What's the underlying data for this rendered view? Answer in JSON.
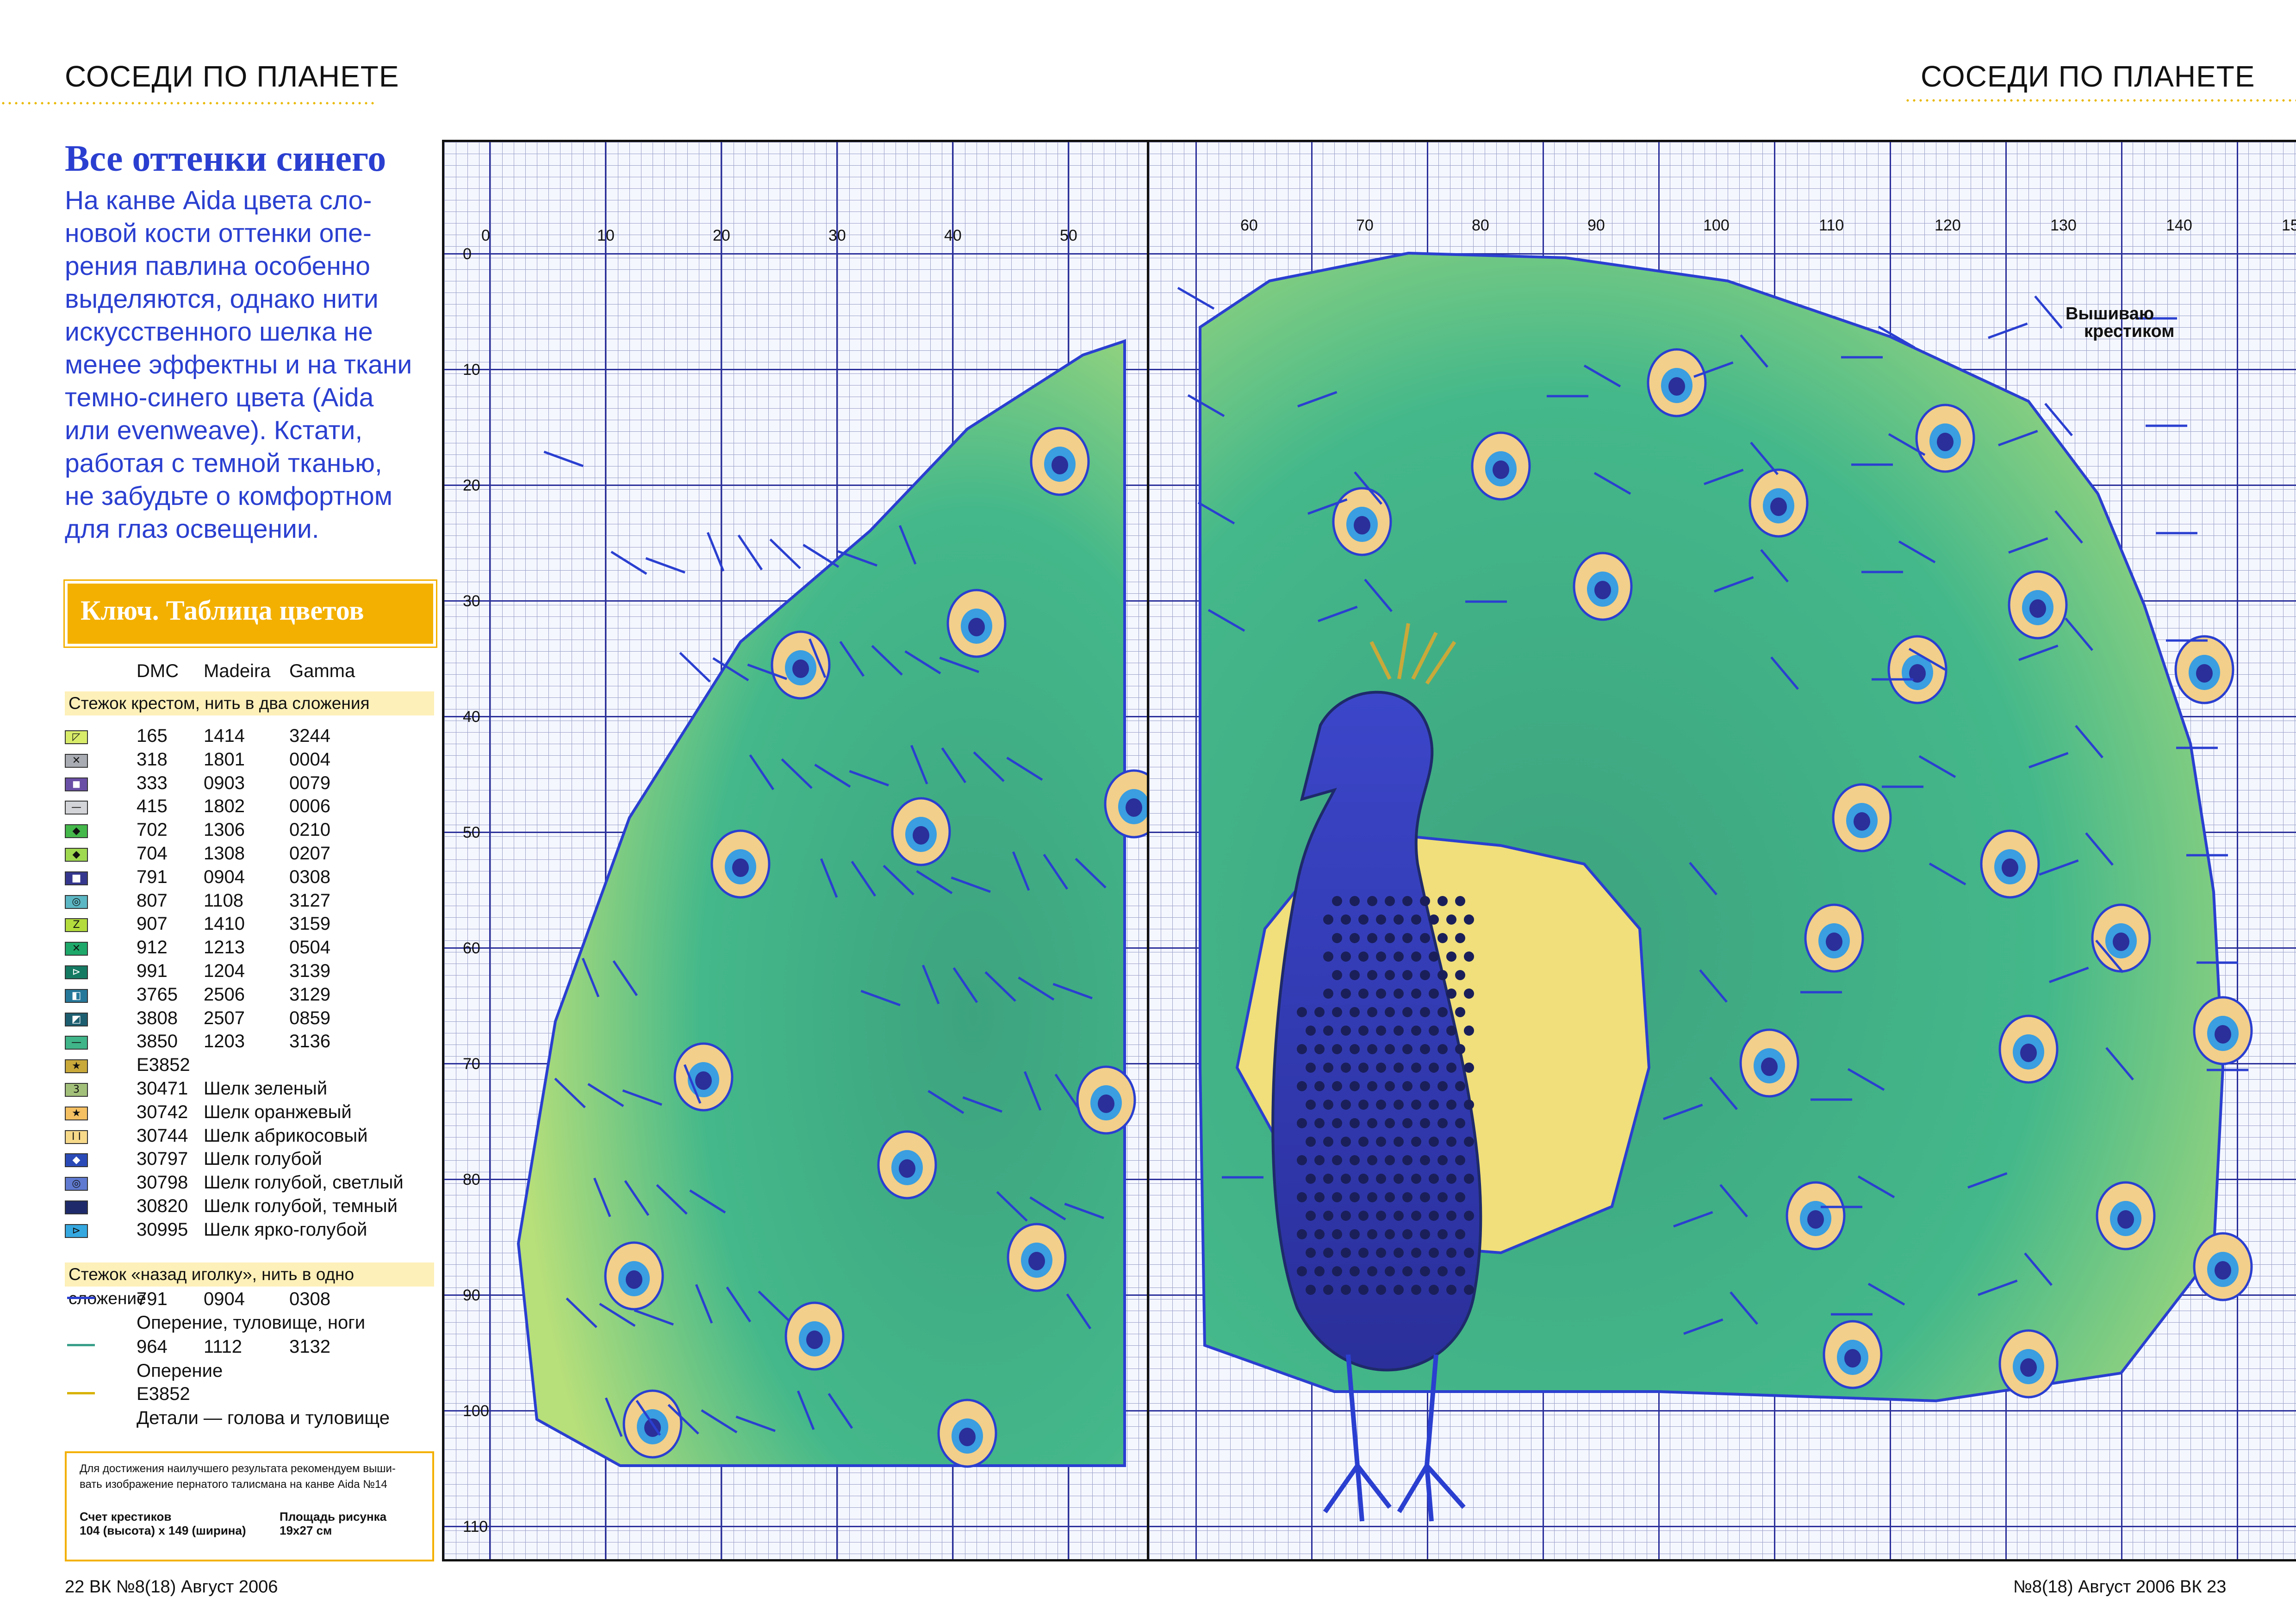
{
  "header": {
    "left_section": "СОСЕДИ ПО ПЛАНЕТЕ",
    "right_section": "СОСЕДИ ПО ПЛАНЕТЕ"
  },
  "article": {
    "headline": "Все оттенки синего",
    "intro_lines": [
      "На канве Aida цвета сло-",
      "новой кости оттенки опе-",
      "рения павлина особенно",
      "выделяются, однако нити",
      "искусственного шелка не",
      "менее эффектны и на ткани",
      "темно-синего цвета (Aida",
      "или evenweave). Кстати,",
      "работая с темной тканью,",
      "не забудьте о комфортном",
      "для глаз освещении."
    ]
  },
  "key": {
    "title": "Ключ. Таблица цветов",
    "columns": [
      "DMC",
      "Madeira",
      "Gamma"
    ],
    "cross_stitch_title": "Стежок крестом, нить в два сложения",
    "rows": [
      {
        "dmc": "165",
        "madeira": "1414",
        "gamma": "3244",
        "color": "#d9ec6a",
        "symbol": "◸"
      },
      {
        "dmc": "318",
        "madeira": "1801",
        "gamma": "0004",
        "color": "#a9acb2",
        "symbol": "✕"
      },
      {
        "dmc": "333",
        "madeira": "0903",
        "gamma": "0079",
        "color": "#6a4fa6",
        "symbol": "◼"
      },
      {
        "dmc": "415",
        "madeira": "1802",
        "gamma": "0006",
        "color": "#d2d4d8",
        "symbol": "—"
      },
      {
        "dmc": "702",
        "madeira": "1306",
        "gamma": "0210",
        "color": "#44b84a",
        "symbol": "◆"
      },
      {
        "dmc": "704",
        "madeira": "1308",
        "gamma": "0207",
        "color": "#9fd94f",
        "symbol": "◆"
      },
      {
        "dmc": "791",
        "madeira": "0904",
        "gamma": "0308",
        "color": "#35378e",
        "symbol": "■"
      },
      {
        "dmc": "807",
        "madeira": "1108",
        "gamma": "3127",
        "color": "#5cb7c4",
        "symbol": "◎"
      },
      {
        "dmc": "907",
        "madeira": "1410",
        "gamma": "3159",
        "color": "#b3dc3c",
        "symbol": "Z"
      },
      {
        "dmc": "912",
        "madeira": "1213",
        "gamma": "0504",
        "color": "#1ea86a",
        "symbol": "✕"
      },
      {
        "dmc": "991",
        "madeira": "1204",
        "gamma": "3139",
        "color": "#157a62",
        "symbol": "⊳"
      },
      {
        "dmc": "3765",
        "madeira": "2506",
        "gamma": "3129",
        "color": "#26789a",
        "symbol": "◧"
      },
      {
        "dmc": "3808",
        "madeira": "2507",
        "gamma": "0859",
        "color": "#1d5e70",
        "symbol": "◩"
      },
      {
        "dmc": "3850",
        "madeira": "1203",
        "gamma": "3136",
        "color": "#3fb589",
        "symbol": "—"
      },
      {
        "dmc": "E3852",
        "madeira": "",
        "gamma": "",
        "color": "#c9a93a",
        "symbol": "★"
      },
      {
        "dmc": "30471",
        "madeira": "Шелк зеленый",
        "gamma": "",
        "color": "#a3c07a",
        "symbol": "3"
      },
      {
        "dmc": "30742",
        "madeira": "Шелк оранжевый",
        "gamma": "",
        "color": "#f5c062",
        "symbol": "★"
      },
      {
        "dmc": "30744",
        "madeira": "Шелк абрикосовый",
        "gamma": "",
        "color": "#f7d98a",
        "symbol": "I I"
      },
      {
        "dmc": "30797",
        "madeira": "Шелк голубой",
        "gamma": "",
        "color": "#2a4ab8",
        "symbol": "◆"
      },
      {
        "dmc": "30798",
        "madeira": "Шелк голубой, светлый",
        "gamma": "",
        "color": "#5f7ad0",
        "symbol": "◎"
      },
      {
        "dmc": "30820",
        "madeira": "Шелк голубой, темный",
        "gamma": "",
        "color": "#1e2a6a",
        "symbol": ""
      },
      {
        "dmc": "30995",
        "madeira": "Шелк ярко-голубой",
        "gamma": "",
        "color": "#35a8e0",
        "symbol": "⊳"
      }
    ],
    "backstitch_title": "Стежок «назад иголку», нить в одно сложение",
    "backstitch": [
      {
        "color": "#2a3fd0",
        "code_line": [
          "791",
          "0904",
          "0308"
        ],
        "desc": "Оперение, туловище, ноги"
      },
      {
        "color": "#3aa08a",
        "code_line": [
          "964",
          "1112",
          "3132"
        ],
        "desc": "Оперение"
      },
      {
        "color": "#d8b100",
        "code_line": [
          "E3852",
          "",
          ""
        ],
        "desc": "Детали — голова и туловище"
      }
    ]
  },
  "note": {
    "text_line1": "Для достижения наилучшего результата рекомендуем выши-",
    "text_line2": "вать изображение пернатого талисмана на канве Aida №14",
    "count_label": "Счет крестиков",
    "count_value": "104 (высота) х 149 (ширина)",
    "area_label": "Площадь рисунка",
    "area_value": "19х27 см"
  },
  "footer": {
    "left": "22 ВК №8(18) Август 2006",
    "right": "№8(18) Август 2006 ВК 23"
  },
  "logo": {
    "line1": "Вышиваю",
    "line2": "крестиком"
  },
  "chart_data": {
    "type": "heatmap",
    "x_ticks_left": [
      "0",
      "10",
      "20",
      "30",
      "40",
      "50"
    ],
    "x_ticks_right": [
      "60",
      "70",
      "80",
      "90",
      "100",
      "110",
      "120",
      "130",
      "140",
      "15"
    ],
    "y_ticks": [
      "0",
      "10",
      "20",
      "30",
      "40",
      "50",
      "60",
      "70",
      "80",
      "90",
      "100",
      "110"
    ]
  }
}
